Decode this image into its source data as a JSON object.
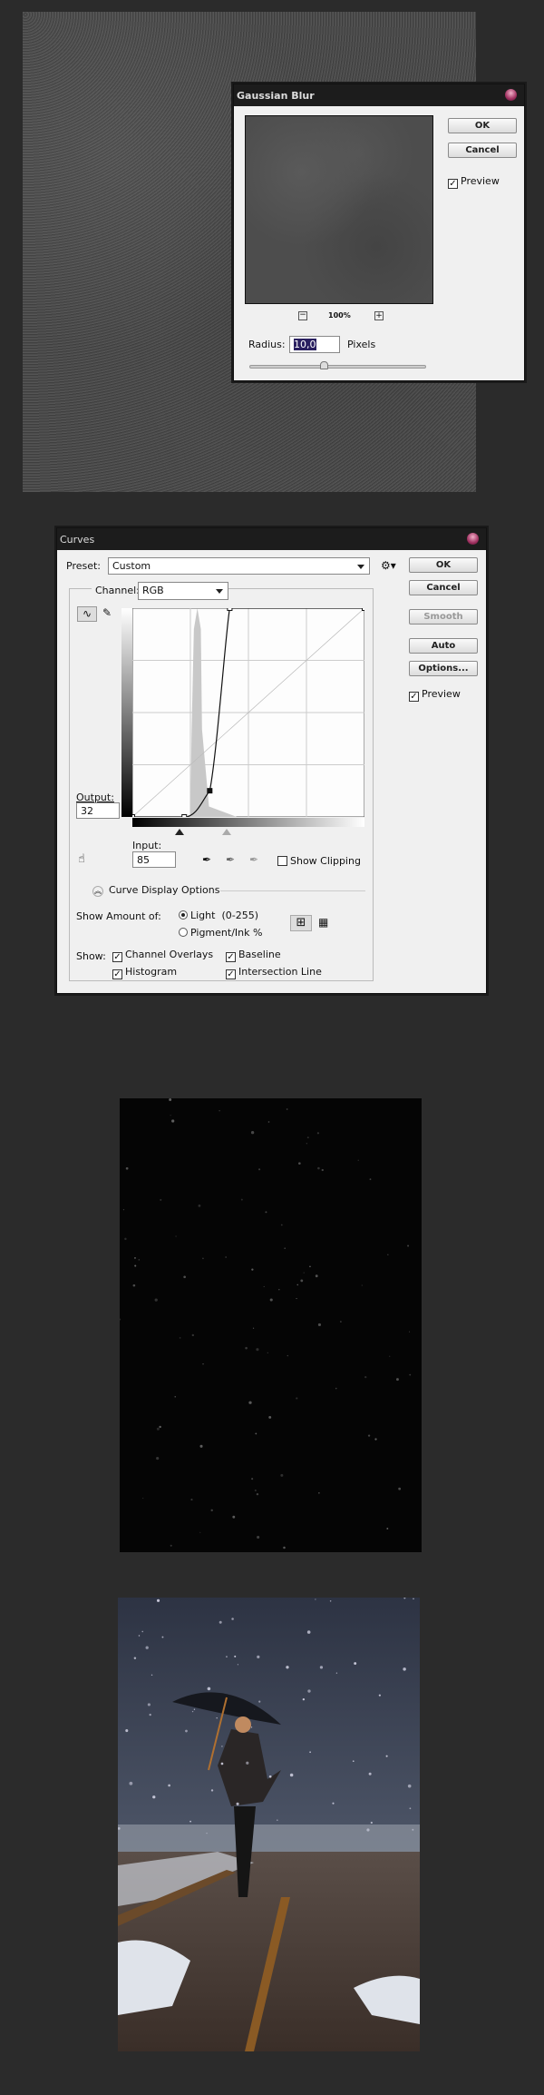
{
  "gaussian_blur": {
    "title": "Gaussian Blur",
    "ok": "OK",
    "cancel": "Cancel",
    "preview_label": "Preview",
    "preview_checked": true,
    "zoom_level": "100%",
    "radius_label": "Radius:",
    "radius_value": "10,0",
    "unit": "Pixels",
    "slider_fraction": 0.4
  },
  "curves": {
    "title": "Curves",
    "preset_label": "Preset:",
    "preset_value": "Custom",
    "channel_label": "Channel:",
    "channel_value": "RGB",
    "buttons": {
      "ok": "OK",
      "cancel": "Cancel",
      "smooth": "Smooth",
      "auto": "Auto",
      "options": "Options..."
    },
    "preview_label": "Preview",
    "output_label": "Output:",
    "output_value": "32",
    "input_label": "Input:",
    "input_value": "85",
    "show_clipping": "Show Clipping",
    "display_options": "Curve Display Options",
    "show_amount_label": "Show Amount of:",
    "light": "Light  (0-255)",
    "pigment": "Pigment/Ink %",
    "show_label": "Show:",
    "channel_overlays": "Channel Overlays",
    "baseline": "Baseline",
    "histogram": "Histogram",
    "intersection_line": "Intersection Line",
    "curve_points": [
      [
        0,
        0
      ],
      [
        57,
        0
      ],
      [
        85,
        32
      ],
      [
        107,
        255
      ],
      [
        255,
        255
      ]
    ]
  },
  "colors": {
    "app_bg": "#2b2b2b",
    "dialog_bg": "#f0f0f0",
    "titlebar": "#1c1c1c",
    "selection": "#2a2060"
  }
}
